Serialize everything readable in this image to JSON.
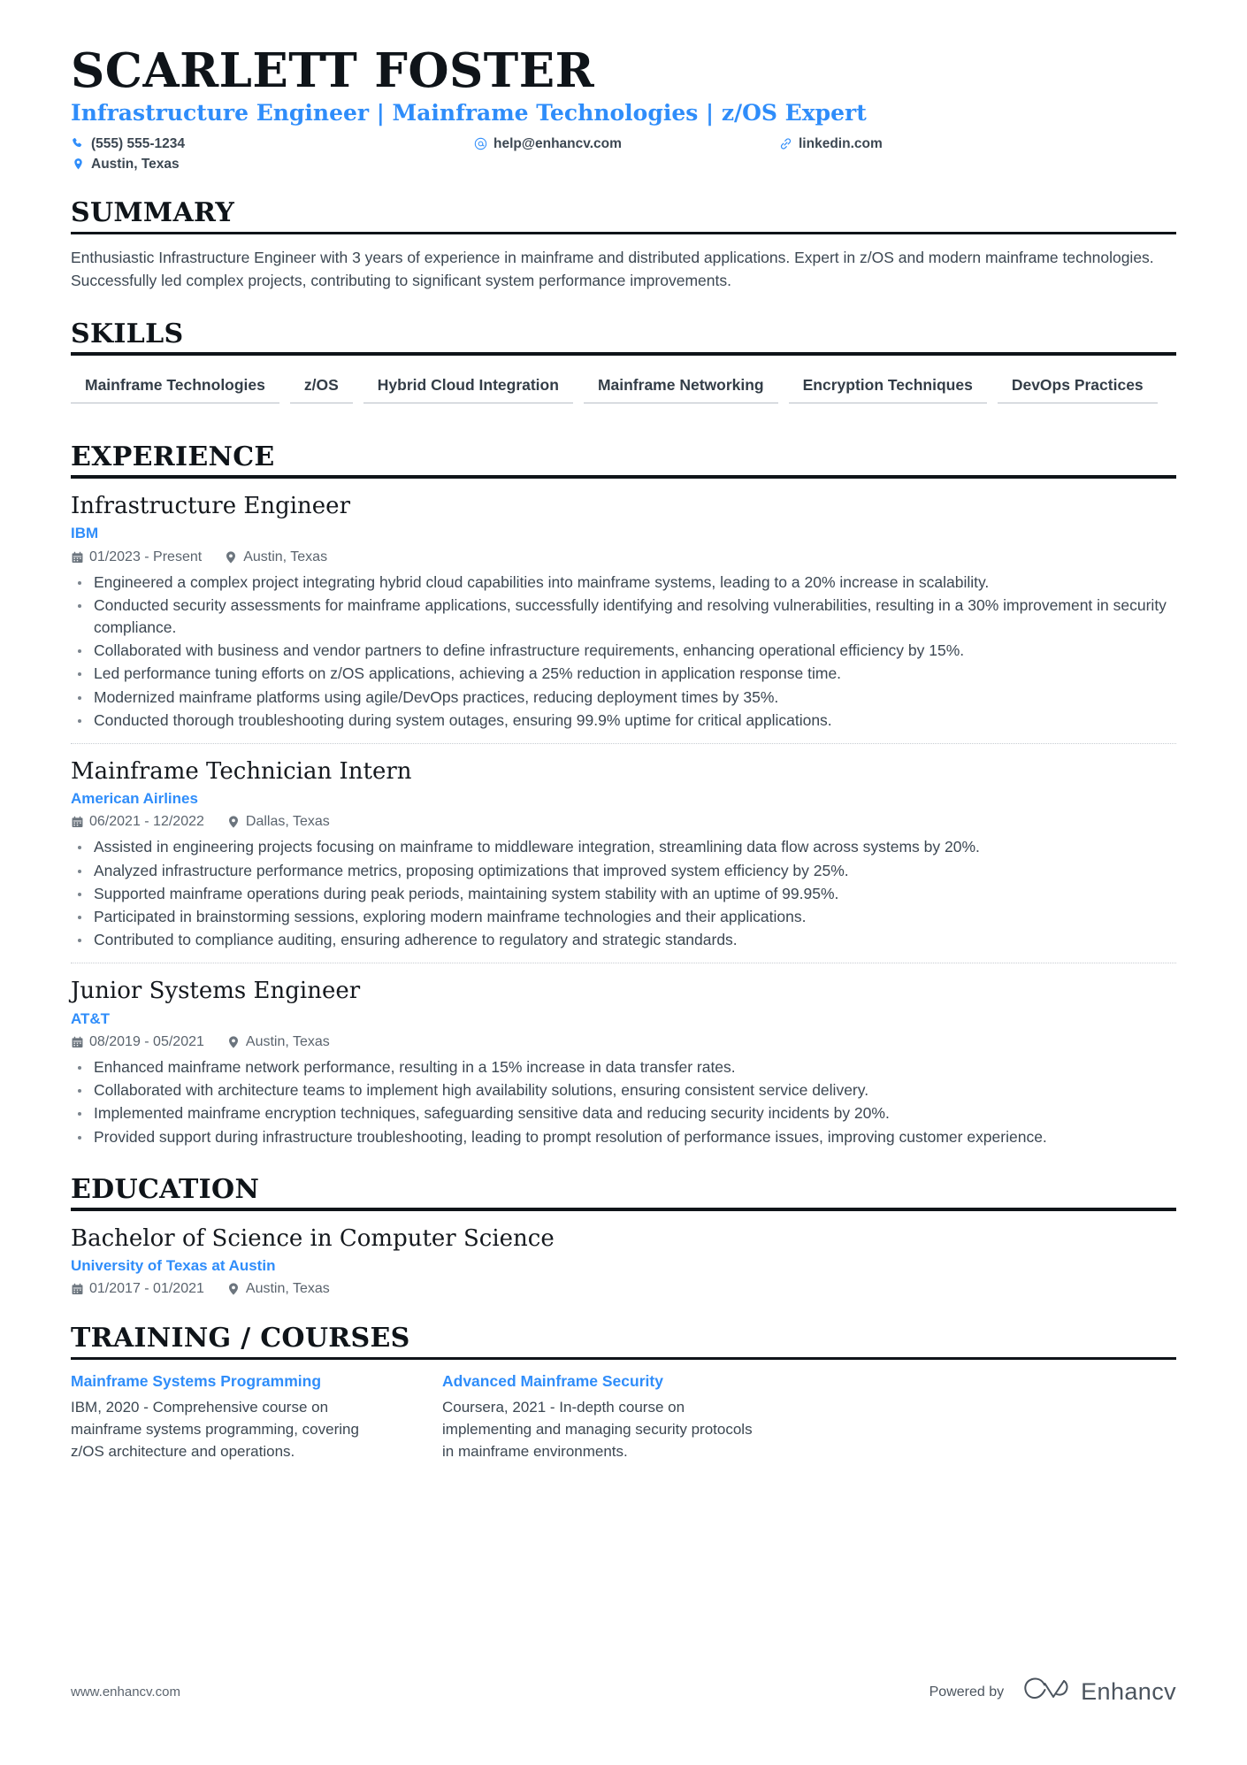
{
  "header": {
    "name": "SCARLETT FOSTER",
    "headline": "Infrastructure Engineer | Mainframe Technologies | z/OS Expert",
    "contacts": [
      {
        "icon": "phone-icon",
        "text": "(555) 555-1234"
      },
      {
        "icon": "email-icon",
        "text": "help@enhancv.com"
      },
      {
        "icon": "link-icon",
        "text": "linkedin.com"
      },
      {
        "icon": "location-icon",
        "text": "Austin, Texas"
      }
    ]
  },
  "summary": {
    "title": "SUMMARY",
    "text": "Enthusiastic Infrastructure Engineer with 3 years of experience in mainframe and distributed applications. Expert in z/OS and modern mainframe technologies. Successfully led complex projects, contributing to significant system performance improvements."
  },
  "skills": {
    "title": "SKILLS",
    "items": [
      "Mainframe Technologies",
      "z/OS",
      "Hybrid Cloud Integration",
      "Mainframe Networking",
      "Encryption Techniques",
      "DevOps Practices"
    ]
  },
  "experience": {
    "title": "EXPERIENCE",
    "entries": [
      {
        "role": "Infrastructure Engineer",
        "company": "IBM",
        "dates": "01/2023 - Present",
        "location": "Austin, Texas",
        "bullets": [
          "Engineered a complex project integrating hybrid cloud capabilities into mainframe systems, leading to a 20% increase in scalability.",
          "Conducted security assessments for mainframe applications, successfully identifying and resolving vulnerabilities, resulting in a 30% improvement in security compliance.",
          "Collaborated with business and vendor partners to define infrastructure requirements, enhancing operational efficiency by 15%.",
          "Led performance tuning efforts on z/OS applications, achieving a 25% reduction in application response time.",
          "Modernized mainframe platforms using agile/DevOps practices, reducing deployment times by 35%.",
          "Conducted thorough troubleshooting during system outages, ensuring 99.9% uptime for critical applications."
        ]
      },
      {
        "role": "Mainframe Technician Intern",
        "company": "American Airlines",
        "dates": "06/2021 - 12/2022",
        "location": "Dallas, Texas",
        "bullets": [
          "Assisted in engineering projects focusing on mainframe to middleware integration, streamlining data flow across systems by 20%.",
          "Analyzed infrastructure performance metrics, proposing optimizations that improved system efficiency by 25%.",
          "Supported mainframe operations during peak periods, maintaining system stability with an uptime of 99.95%.",
          "Participated in brainstorming sessions, exploring modern mainframe technologies and their applications.",
          "Contributed to compliance auditing, ensuring adherence to regulatory and strategic standards."
        ]
      },
      {
        "role": "Junior Systems Engineer",
        "company": "AT&T",
        "dates": "08/2019 - 05/2021",
        "location": "Austin, Texas",
        "bullets": [
          "Enhanced mainframe network performance, resulting in a 15% increase in data transfer rates.",
          "Collaborated with architecture teams to implement high availability solutions, ensuring consistent service delivery.",
          "Implemented mainframe encryption techniques, safeguarding sensitive data and reducing security incidents by 20%.",
          "Provided support during infrastructure troubleshooting, leading to prompt resolution of performance issues, improving customer experience."
        ]
      }
    ]
  },
  "education": {
    "title": "EDUCATION",
    "entries": [
      {
        "degree": "Bachelor of Science in Computer Science",
        "school": "University of Texas at Austin",
        "dates": "01/2017 - 01/2021",
        "location": "Austin, Texas"
      }
    ]
  },
  "training": {
    "title": "TRAINING / COURSES",
    "courses": [
      {
        "name": "Mainframe Systems Programming",
        "description": "IBM, 2020 - Comprehensive course on mainframe systems programming, covering z/OS architecture and operations."
      },
      {
        "name": "Advanced Mainframe Security",
        "description": "Coursera, 2021 - In-depth course on implementing and managing security protocols in mainframe environments."
      }
    ]
  },
  "footer": {
    "url": "www.enhancv.com",
    "powered_by": "Powered by",
    "brand": "Enhancv"
  },
  "colors": {
    "accent": "#2f8dfa",
    "text": "#3c4752",
    "heading": "#0f1419"
  }
}
